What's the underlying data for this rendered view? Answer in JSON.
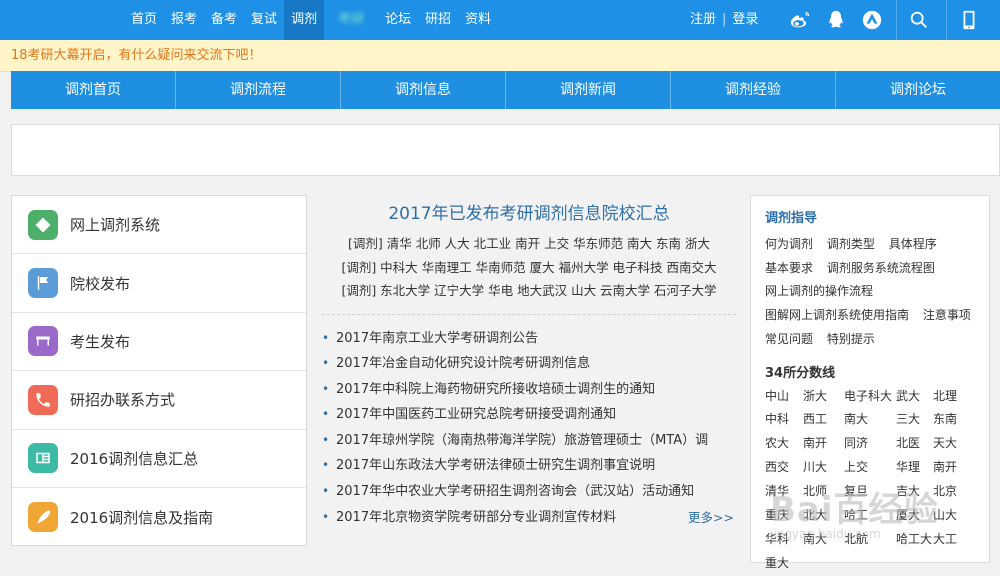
{
  "top_nav": {
    "links": [
      "首页",
      "报考",
      "备考",
      "复试",
      "调剂",
      "考研",
      "论坛",
      "研招",
      "资料"
    ],
    "register": "注册",
    "separator": "|",
    "login": "登录",
    "icons": [
      "weibo-icon",
      "qq-icon",
      "app-icon",
      "search-icon",
      "mobile-icon"
    ]
  },
  "notice": "18考研大幕开启，有什么疑问来交流下吧！",
  "sub_nav": [
    "调剂首页",
    "调剂流程",
    "调剂信息",
    "调剂新闻",
    "调剂经验",
    "调剂论坛"
  ],
  "left_menu": [
    {
      "label": "网上调剂系统",
      "icon": "system-icon",
      "color": "#4caf6a"
    },
    {
      "label": "院校发布",
      "icon": "flag-icon",
      "color": "#5b9bd8"
    },
    {
      "label": "考生发布",
      "icon": "student-icon",
      "color": "#9b6ac8"
    },
    {
      "label": "研招办联系方式",
      "icon": "phone-icon",
      "color": "#ef6a57"
    },
    {
      "label": "2016调剂信息汇总",
      "icon": "document-icon",
      "color": "#3cbaa6"
    },
    {
      "label": "2016调剂信息及指南",
      "icon": "pen-icon",
      "color": "#efa635"
    }
  ],
  "center": {
    "title": "2017年已发布考研调剂信息院校汇总",
    "taglines": [
      "[调剂] 清华 北师 人大 北工业 南开 上交 华东师范 南大 东南 浙大",
      "[调剂] 中科大 华南理工 华南师范 厦大 福州大学 电子科技 西南交大",
      "[调剂] 东北大学 辽宁大学 华电 地大武汉 山大 云南大学 石河子大学"
    ],
    "news": [
      "2017年南京工业大学考研调剂公告",
      "2017年冶金自动化研究设计院考研调剂信息",
      "2017年中科院上海药物研究所接收培硕士调剂生的通知",
      "2017年中国医药工业研究总院考研接受调剂通知",
      "2017年琼州学院（海南热带海洋学院）旅游管理硕士（MTA）调",
      "2017年山东政法大学考研法律硕士研究生调剂事宜说明",
      "2017年华中农业大学考研招生调剂咨询会（武汉站）活动通知",
      "2017年北京物资学院考研部分专业调剂宣传材料"
    ],
    "more": "更多>>"
  },
  "right": {
    "guide_title": "调剂指导",
    "guide_rows": [
      [
        "何为调剂",
        "调剂类型",
        "具体程序"
      ],
      [
        "基本要求",
        "调剂服务系统流程图"
      ],
      [
        "网上调剂的操作流程"
      ],
      [
        "图解网上调剂系统使用指南",
        "注意事项"
      ],
      [
        "常见问题",
        "特别提示"
      ]
    ],
    "score_title": "34所分数线",
    "schools": [
      "中山",
      "浙大",
      "电子科大",
      "武大",
      "北理",
      "中科",
      "西工",
      "南大",
      "三大",
      "东南",
      "农大",
      "南开",
      "同济",
      "北医",
      "天大",
      "西交",
      "川大",
      "上交",
      "华理",
      "南开",
      "清华",
      "北师",
      "复旦",
      "吉大",
      "北京",
      "重庆",
      "北大",
      "哈工",
      "厦大",
      "山大",
      "华科",
      "南大",
      "北航",
      "哈工大",
      "大工",
      "重大"
    ]
  },
  "watermark": "Bai百经验",
  "watermark_url": "jingyan.baidu.com"
}
